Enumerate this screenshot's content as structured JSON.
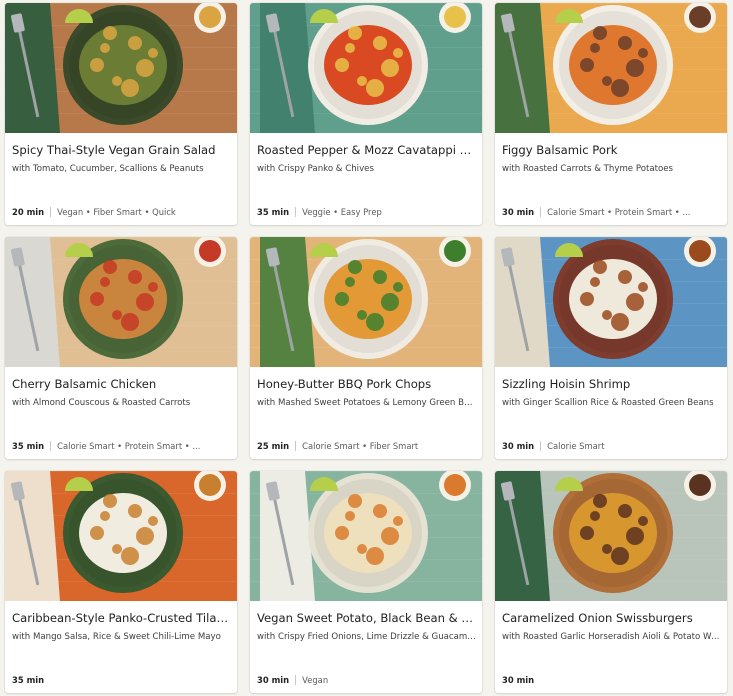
{
  "recipes": [
    {
      "title": "Spicy Thai-Style Vegan Grain Salad",
      "subtitle": "with Tomato, Cucumber, Scallions & Peanuts",
      "time": "20 min",
      "tags": "Vegan • Fiber Smart • Quick",
      "photo": {
        "background": "#b7794a",
        "plate": "#3b4a2a",
        "food": "#6b7d35",
        "accent": "#d9a441",
        "cloth": "#2f5e3e"
      }
    },
    {
      "title": "Roasted Pepper & Mozz Cavatappi Bake",
      "subtitle": "with Crispy Panko & Chives",
      "time": "35 min",
      "tags": "Veggie • Easy Prep",
      "photo": {
        "background": "#5f9f8c",
        "plate": "#f2ede4",
        "food": "#d94a22",
        "accent": "#e8c14a",
        "cloth": "#3f7f6c"
      }
    },
    {
      "title": "Figgy Balsamic Pork",
      "subtitle": "with Roasted Carrots & Thyme Potatoes",
      "time": "30 min",
      "tags": "Calorie Smart • Protein Smart • ...",
      "photo": {
        "background": "#eba94f",
        "plate": "#f4efe6",
        "food": "#e0772e",
        "accent": "#6b3e2a",
        "cloth": "#3e6e3e"
      }
    },
    {
      "title": "Cherry Balsamic Chicken",
      "subtitle": "with Almond Couscous & Roasted Carrots",
      "time": "35 min",
      "tags": "Calorie Smart • Protein Smart • ...",
      "photo": {
        "background": "#dfbf93",
        "plate": "#4d6a3a",
        "food": "#c9853e",
        "accent": "#c53a26",
        "cloth": "#d9d9d5"
      }
    },
    {
      "title": "Honey-Butter BBQ Pork Chops",
      "subtitle": "with Mashed Sweet Potatoes & Lemony Green Beans",
      "time": "25 min",
      "tags": "Calorie Smart • Fiber Smart",
      "photo": {
        "background": "#e3b47a",
        "plate": "#f1ece3",
        "food": "#e39a36",
        "accent": "#3e7f2e",
        "cloth": "#4d7e3e"
      }
    },
    {
      "title": "Sizzling Hoisin Shrimp",
      "subtitle": "with Ginger Scallion Rice & Roasted Green Beans",
      "time": "30 min",
      "tags": "Calorie Smart",
      "photo": {
        "background": "#5c95c4",
        "plate": "#7d3c2e",
        "food": "#efe9dc",
        "accent": "#9a4a1c",
        "cloth": "#e8dcc8"
      }
    },
    {
      "title": "Caribbean-Style Panko-Crusted Tilapia",
      "subtitle": "with Mango Salsa, Rice & Sweet Chili-Lime Mayo",
      "time": "35 min",
      "tags": "",
      "photo": {
        "background": "#d9662a",
        "plate": "#3c5a30",
        "food": "#f1ece0",
        "accent": "#c9802e",
        "cloth": "#efe6d6"
      }
    },
    {
      "title": "Vegan Sweet Potato, Black Bean & Kale ...",
      "subtitle": "with Crispy Fried Onions, Lime Drizzle & Guacamole",
      "time": "30 min",
      "tags": "Vegan",
      "photo": {
        "background": "#86b49f",
        "plate": "#e6e2d3",
        "food": "#efe0bd",
        "accent": "#d97a2e",
        "cloth": "#f2efe8"
      }
    },
    {
      "title": "Caramelized Onion Swissburgers",
      "subtitle": "with Roasted Garlic Horseradish Aioli & Potato Wed...",
      "time": "30 min",
      "tags": "",
      "photo": {
        "background": "#b9c4ba",
        "plate": "#b06e38",
        "food": "#d8962f",
        "accent": "#5a3320",
        "cloth": "#2f5e3e"
      }
    }
  ]
}
